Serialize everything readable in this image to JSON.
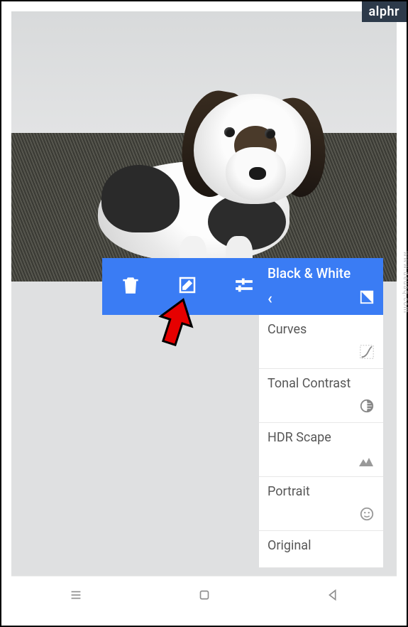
{
  "badge": "alphr",
  "watermark": "www.deuaq.com",
  "toolbar": {
    "delete_icon": "trash-icon",
    "edit_icon": "edit-icon",
    "adjust_icon": "sliders-icon"
  },
  "panel": {
    "active": {
      "label": "Black & White",
      "back_icon": "chevron-left-icon",
      "type_icon": "contrast-square-icon"
    },
    "items": [
      {
        "label": "Curves",
        "icon": "curves-icon"
      },
      {
        "label": "Tonal Contrast",
        "icon": "tonal-contrast-icon"
      },
      {
        "label": "HDR Scape",
        "icon": "mountains-icon"
      },
      {
        "label": "Portrait",
        "icon": "face-icon"
      },
      {
        "label": "Original",
        "icon": ""
      }
    ]
  },
  "nav": {
    "recents_icon": "recents-icon",
    "home_icon": "home-icon",
    "back_icon": "back-icon"
  },
  "colors": {
    "accent": "#3a7cf4",
    "panel_bg": "#ffffff",
    "screen_bg": "#dfe0e1",
    "text_muted": "#575757"
  }
}
